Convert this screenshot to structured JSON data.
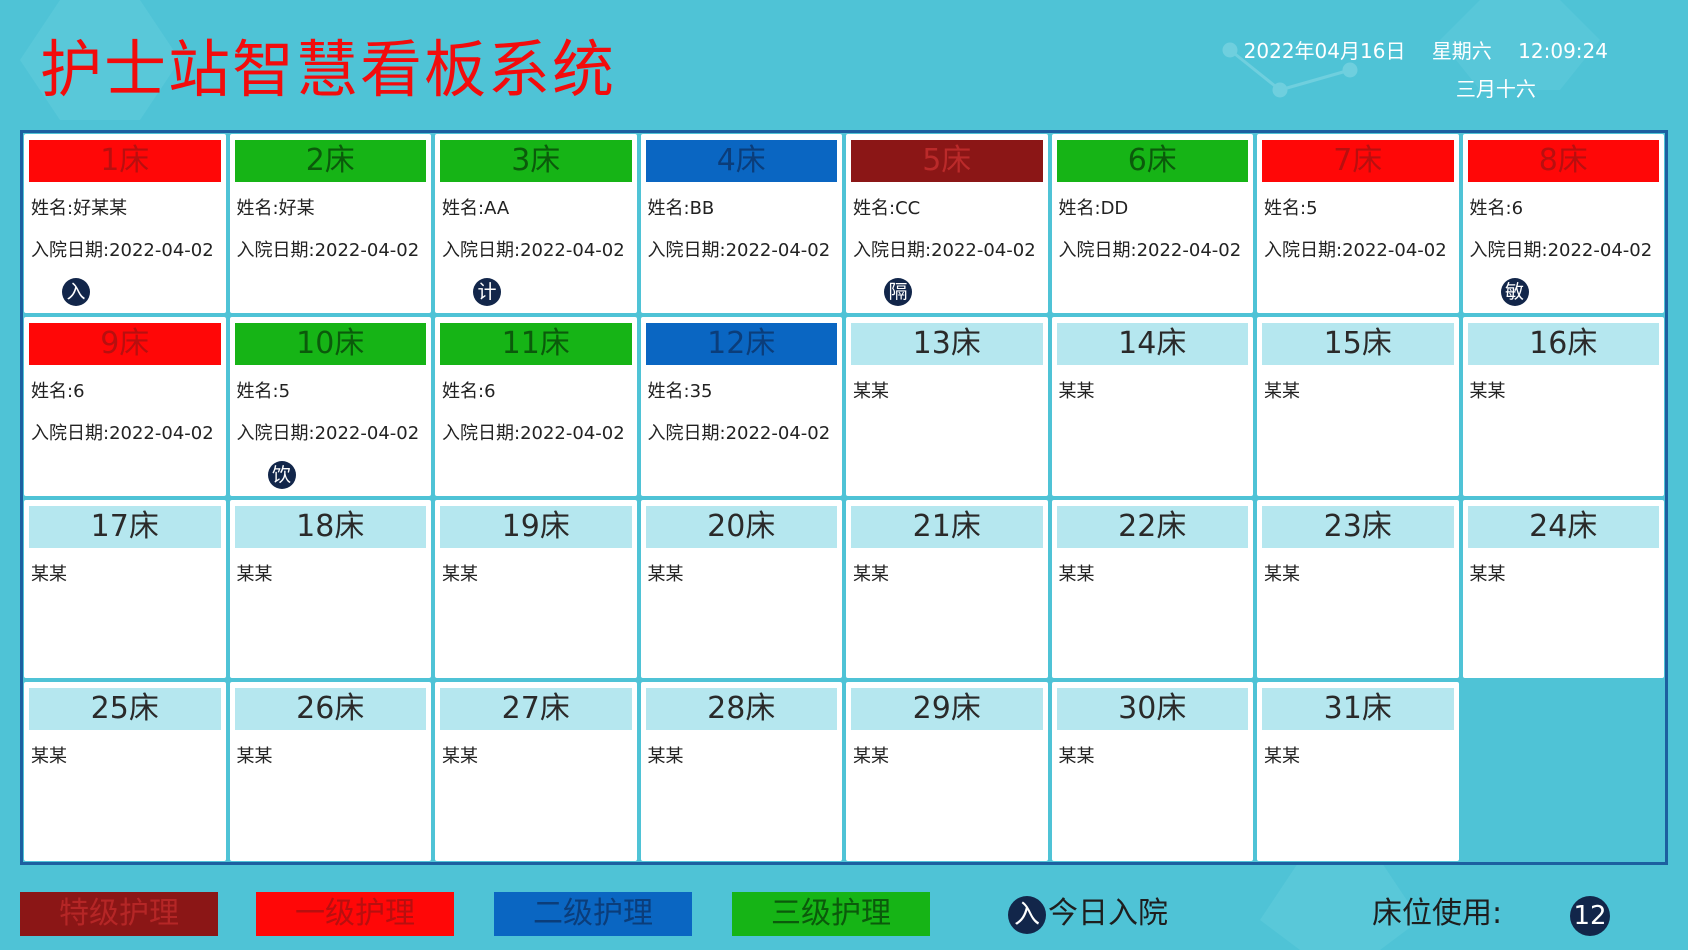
{
  "header": {
    "title": "护士站智慧看板系统",
    "date": "2022年04月16日",
    "weekday": "星期六",
    "time": "12:09:24",
    "lunar_date": "三月十六"
  },
  "colors": {
    "special": "#8b1616",
    "level1": "#ff0707",
    "level2": "#0a66c2",
    "level3": "#16b416",
    "empty": "#b5e7ef",
    "badge": "#12264a"
  },
  "beds": [
    {
      "label": "1床",
      "level": "level1",
      "name": "姓名:好某某",
      "date": "入院日期:2022-04-02",
      "badge": "入"
    },
    {
      "label": "2床",
      "level": "level3",
      "name": "姓名:好某",
      "date": "入院日期:2022-04-02",
      "badge": ""
    },
    {
      "label": "3床",
      "level": "level3",
      "name": "姓名:AA",
      "date": "入院日期:2022-04-02",
      "badge": "计"
    },
    {
      "label": "4床",
      "level": "level2",
      "name": "姓名:BB",
      "date": "入院日期:2022-04-02",
      "badge": ""
    },
    {
      "label": "5床",
      "level": "special",
      "name": "姓名:CC",
      "date": "入院日期:2022-04-02",
      "badge": "隔"
    },
    {
      "label": "6床",
      "level": "level3",
      "name": "姓名:DD",
      "date": "入院日期:2022-04-02",
      "badge": ""
    },
    {
      "label": "7床",
      "level": "level1",
      "name": "姓名:5",
      "date": "入院日期:2022-04-02",
      "badge": ""
    },
    {
      "label": "8床",
      "level": "level1",
      "name": "姓名:6",
      "date": "入院日期:2022-04-02",
      "badge": "敏"
    },
    {
      "label": "9床",
      "level": "level1",
      "name": "姓名:6",
      "date": "入院日期:2022-04-02",
      "badge": ""
    },
    {
      "label": "10床",
      "level": "level3",
      "name": "姓名:5",
      "date": "入院日期:2022-04-02",
      "badge": "饮"
    },
    {
      "label": "11床",
      "level": "level3",
      "name": "姓名:6",
      "date": "入院日期:2022-04-02",
      "badge": ""
    },
    {
      "label": "12床",
      "level": "level2",
      "name": "姓名:35",
      "date": "入院日期:2022-04-02",
      "badge": ""
    },
    {
      "label": "13床",
      "level": "empty-bed",
      "name": "某某",
      "date": "",
      "badge": ""
    },
    {
      "label": "14床",
      "level": "empty-bed",
      "name": "某某",
      "date": "",
      "badge": ""
    },
    {
      "label": "15床",
      "level": "empty-bed",
      "name": "某某",
      "date": "",
      "badge": ""
    },
    {
      "label": "16床",
      "level": "empty-bed",
      "name": "某某",
      "date": "",
      "badge": ""
    },
    {
      "label": "17床",
      "level": "empty-bed",
      "name": "某某",
      "date": "",
      "badge": ""
    },
    {
      "label": "18床",
      "level": "empty-bed",
      "name": "某某",
      "date": "",
      "badge": ""
    },
    {
      "label": "19床",
      "level": "empty-bed",
      "name": "某某",
      "date": "",
      "badge": ""
    },
    {
      "label": "20床",
      "level": "empty-bed",
      "name": "某某",
      "date": "",
      "badge": ""
    },
    {
      "label": "21床",
      "level": "empty-bed",
      "name": "某某",
      "date": "",
      "badge": ""
    },
    {
      "label": "22床",
      "level": "empty-bed",
      "name": "某某",
      "date": "",
      "badge": ""
    },
    {
      "label": "23床",
      "level": "empty-bed",
      "name": "某某",
      "date": "",
      "badge": ""
    },
    {
      "label": "24床",
      "level": "empty-bed",
      "name": "某某",
      "date": "",
      "badge": ""
    },
    {
      "label": "25床",
      "level": "empty-bed",
      "name": "某某",
      "date": "",
      "badge": ""
    },
    {
      "label": "26床",
      "level": "empty-bed",
      "name": "某某",
      "date": "",
      "badge": ""
    },
    {
      "label": "27床",
      "level": "empty-bed",
      "name": "某某",
      "date": "",
      "badge": ""
    },
    {
      "label": "28床",
      "level": "empty-bed",
      "name": "某某",
      "date": "",
      "badge": ""
    },
    {
      "label": "29床",
      "level": "empty-bed",
      "name": "某某",
      "date": "",
      "badge": ""
    },
    {
      "label": "30床",
      "level": "empty-bed",
      "name": "某某",
      "date": "",
      "badge": ""
    },
    {
      "label": "31床",
      "level": "empty-bed",
      "name": "某某",
      "date": "",
      "badge": ""
    }
  ],
  "legend": {
    "special": "特级护理",
    "level1": "一级护理",
    "level2": "二级护理",
    "level3": "三级护理",
    "admit_badge": "入",
    "admit_label": "今日入院",
    "usage_label": "床位使用:",
    "usage_value": "12"
  }
}
